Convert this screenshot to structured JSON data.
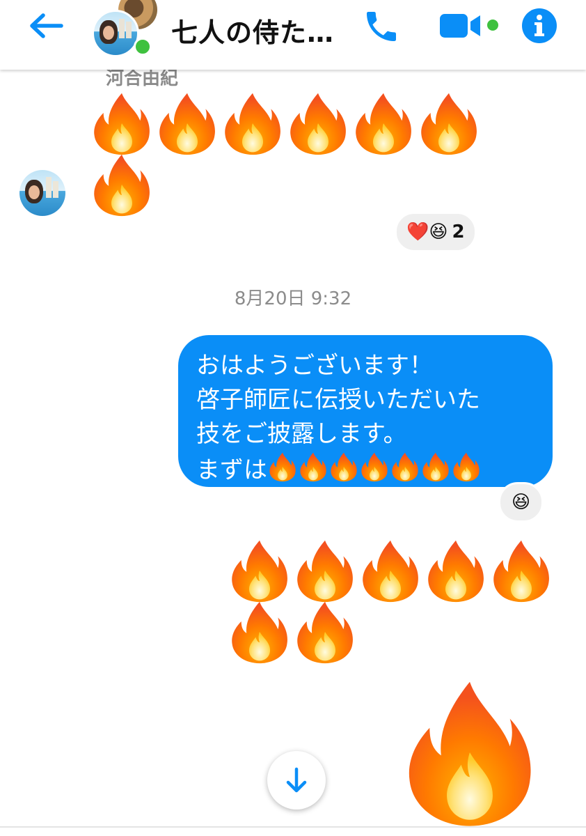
{
  "header": {
    "title": "七人の侍た…",
    "icons": [
      "back-arrow-icon",
      "group-avatar",
      "phone-icon",
      "video-camera-icon",
      "info-icon"
    ],
    "accent_color": "#0a8ef7",
    "online_color": "#3fc13f"
  },
  "messages": {
    "sender_name": "河合由紀",
    "incoming_emoji": "🔥🔥🔥🔥🔥🔥🔥",
    "incoming_reactions": {
      "emojis": "❤️😆",
      "count": "2"
    },
    "timestamp": "8月20日 9:32",
    "outgoing_text": {
      "line1": "おはようございます！",
      "line2": "啓子師匠に伝授いただいた",
      "line3": "技をご披露します。",
      "line4_text": "まずは",
      "line4_emoji": "🔥🔥🔥🔥🔥🔥🔥"
    },
    "outgoing_reaction": "😆",
    "outgoing_emoji": "🔥🔥🔥🔥🔥🔥🔥",
    "large_emoji": "🔥"
  },
  "controls": {
    "scroll_down_icon": "arrow-down-icon"
  }
}
